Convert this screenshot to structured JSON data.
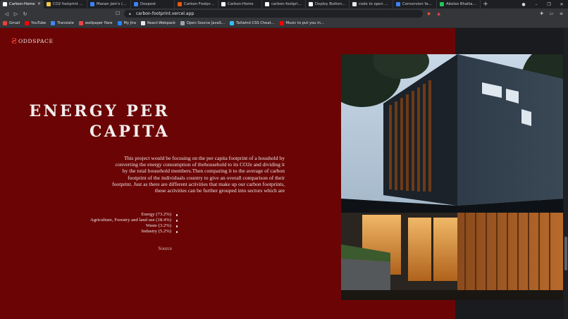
{
  "browser": {
    "tabs": [
      {
        "title": "Carbon-Home",
        "active": true,
        "icon_color": "#ffffff"
      },
      {
        "title": "CO2 footprint - Energ",
        "icon_color": "#f6c744"
      },
      {
        "title": "Manan Jain's (manan",
        "icon_color": "#3b82f6"
      },
      {
        "title": "Deepost",
        "icon_color": "#3b82f6"
      },
      {
        "title": "Carbon Footprint - a",
        "icon_color": "#ea580c"
      },
      {
        "title": "Carbon-Home",
        "icon_color": "#ffffff"
      },
      {
        "title": "carbon-footprint - D",
        "icon_color": "#ffffff"
      },
      {
        "title": "Deploy Button - Verc",
        "icon_color": "#ffffff"
      },
      {
        "title": "code to open chrom",
        "icon_color": "#e5e7eb"
      },
      {
        "title": "Conversion factors",
        "icon_color": "#3b82f6"
      },
      {
        "title": "Abelee Bhattacharya",
        "icon_color": "#22c55e"
      }
    ],
    "url": "carbon-footprint.vercel.app",
    "bookmarks": [
      {
        "label": "Gmail",
        "icon_color": "#ea4335"
      },
      {
        "label": "YouTube",
        "icon_color": "#ff0000"
      },
      {
        "label": "Translate",
        "icon_color": "#4285f4"
      },
      {
        "label": "wallpaper flare",
        "icon_color": "#ef4444"
      },
      {
        "label": "My Jira",
        "icon_color": "#2684ff"
      },
      {
        "label": "React-Webpack",
        "icon_color": "#e5e7eb"
      },
      {
        "label": "Open Source JavaS...",
        "icon_color": "#9ca3af"
      },
      {
        "label": "Tailwind CSS Cheat...",
        "icon_color": "#38bdf8"
      },
      {
        "label": "Music to put you in...",
        "icon_color": "#ff0000"
      }
    ]
  },
  "site": {
    "logo_text": "ODDSPACE",
    "title_line1": "ENERGY PER",
    "title_line2": "CAPITA",
    "description": "This project would be focusing on the per capita footprint of a houshold by converting the energy consumption of thehousehold to its CO2e and dividing it by the total household members.Then comparing it to the average of carbon footprint of the individuals country to give an overall comparison of their footprint. Just as there are different activities that make up our carbon footprints, these activities can be further grouped into sectors which are",
    "sectors": [
      "Energy (73.2%)",
      "Agriculture, Forestry and land use (18.4%)",
      "Waste (3.2%)",
      "Industry (5.2%)"
    ],
    "source_label": "Source",
    "colors": {
      "panel": "#6b0505",
      "accent": "#e03a2f"
    }
  }
}
